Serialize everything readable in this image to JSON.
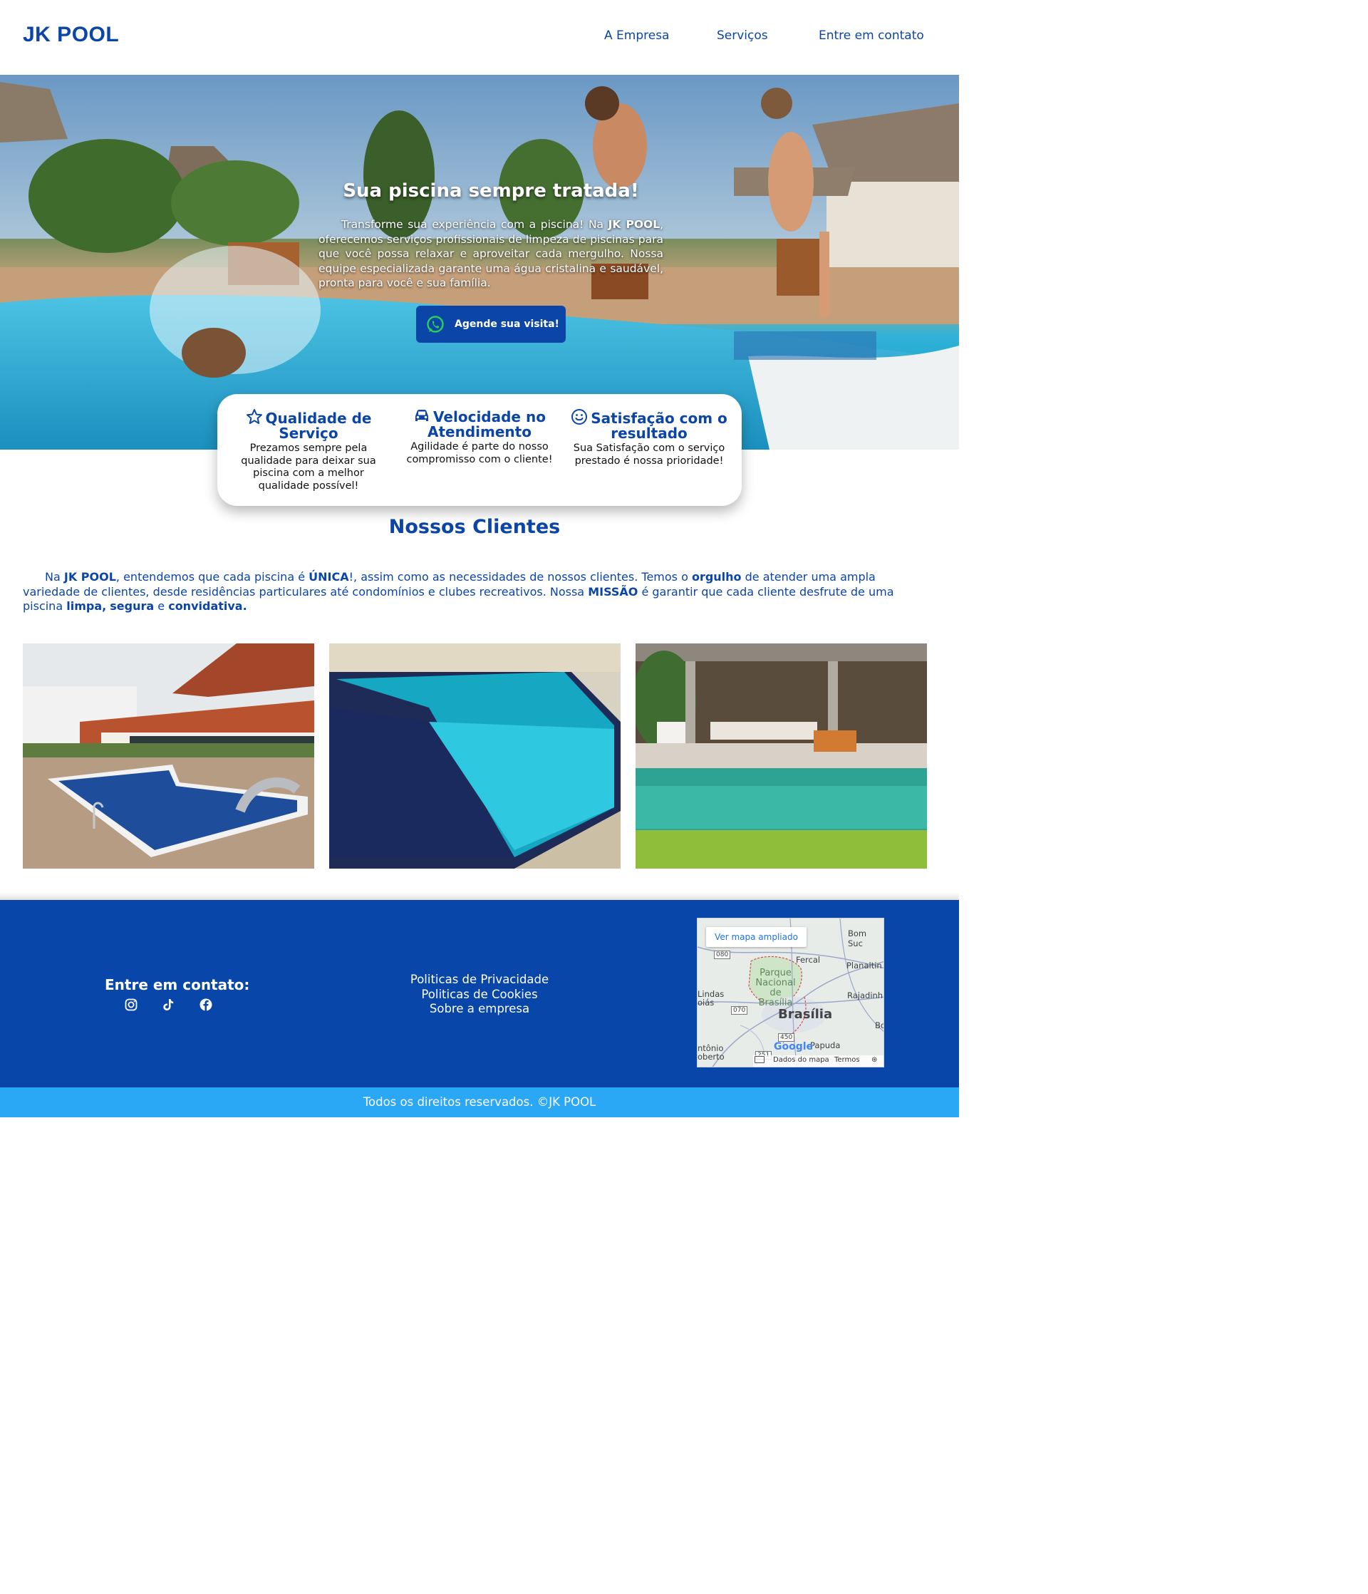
{
  "header": {
    "logo": "JK POOL",
    "nav": [
      "A Empresa",
      "Serviços",
      "Entre em contato"
    ]
  },
  "hero": {
    "title": "Sua piscina sempre tratada!",
    "text_intro": "Transforme sua experiência com a piscina! Na ",
    "brand": "JK POOL",
    "text_rest": ", oferecemos serviços profissionais de limpeza de piscinas para que você possa relaxar e aproveitar cada mergulho. Nossa equipe especializada garante uma água cristalina e saudável, pronta para você e sua família.",
    "cta_label": "Agende sua visita!",
    "cta_icon": "whatsapp-icon"
  },
  "features": [
    {
      "icon": "star-icon",
      "title": "Qualidade de Serviço",
      "desc": "Prezamos sempre pela qualidade para deixar sua piscina com a melhor qualidade possível!"
    },
    {
      "icon": "car-icon",
      "title": "Velocidade no Atendimento",
      "desc": "Agilidade é parte do nosso compromisso com o cliente!"
    },
    {
      "icon": "smile-icon",
      "title": "Satisfação com o resultado",
      "desc": "Sua Satisfação com o serviço prestado é nossa prioridade!"
    }
  ],
  "clients": {
    "title": "Nossos Clientes",
    "p1": "Na ",
    "b1": "JK POOL",
    "p2": ", entendemos que cada piscina é ",
    "b2": "ÚNICA",
    "p3": "!, assim como as necessidades de nossos clientes. Temos o ",
    "b3": "orgulho",
    "p4": " de atender uma ampla variedade de clientes, desde residências particulares até condomínios e clubes recreativos. Nossa ",
    "b4": "MISSÃO",
    "p5": " é garantir que cada cliente desfrute de uma piscina ",
    "b5": "limpa,",
    "p6": " ",
    "b6": "segura",
    "p7": " e ",
    "b7": "convidativa."
  },
  "footer": {
    "contact_title": "Entre em contato:",
    "social_icons": [
      "instagram-icon",
      "tiktok-icon",
      "facebook-icon"
    ],
    "links": [
      "Politicas de Privacidade",
      "Politicas de Cookies",
      "Sobre a empresa"
    ],
    "map": {
      "button": "Ver mapa ampliado",
      "labels": [
        "Bom Suc",
        "Fercal",
        "Planaltin",
        "Parque Nacional de Brasília",
        "Lindas oiás",
        "Rajadinh",
        "Brasília",
        "Bo",
        "Papuda",
        "ntônio oberto"
      ],
      "roads": [
        "080",
        "070",
        "450",
        "251"
      ],
      "attribution": [
        "Dados do mapa",
        "Termos"
      ],
      "brand": "Google"
    },
    "copyright": "Todos os direitos reservados. ©JK POOL"
  },
  "colors": {
    "primary": "#0b45a8",
    "footer": "#0846aa",
    "bottom_bar": "#2aa7f5"
  }
}
